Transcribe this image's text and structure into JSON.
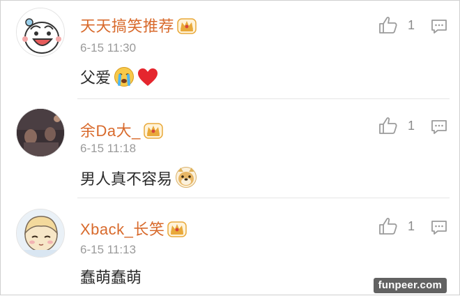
{
  "comments": [
    {
      "username": "天天搞笑推荐",
      "time": "6-15 11:30",
      "text": "父爱",
      "likes": "1",
      "avatar": "cartoon-face-avatar",
      "emojis": [
        "crying-face-icon",
        "red-heart-icon"
      ]
    },
    {
      "username": "余Da大_",
      "time": "6-15 11:18",
      "text": "男人真不容易",
      "likes": "1",
      "avatar": "dim-room-photo-avatar",
      "emojis": [
        "doge-face-icon"
      ]
    },
    {
      "username": "Xback_长笑",
      "time": "6-15 11:13",
      "text": "蠢萌蠢萌",
      "likes": "1",
      "avatar": "anime-girl-avatar",
      "emojis": []
    }
  ],
  "watermark": "funpeer.com",
  "colors": {
    "username": "#d86a2c",
    "time": "#9a9a9a",
    "text": "#2b2b2b",
    "icon": "#9b9b9b",
    "crown": "#e9a93a"
  }
}
